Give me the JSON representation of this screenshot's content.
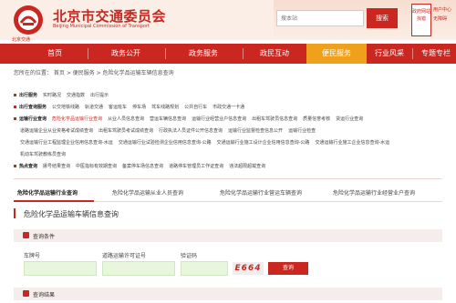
{
  "header": {
    "title": "北京市交通委员会",
    "subtitle": "Beijing Municipal Commission of Transport",
    "logo_text": "北京交通",
    "search_placeholder": "搜本站",
    "search_button": "搜索",
    "badge": "政府网站 找错",
    "user_links": [
      "用户中心",
      "无障碍"
    ]
  },
  "nav": {
    "items": [
      "首页",
      "政务公开",
      "政务服务",
      "政民互动",
      "便民服务",
      "行业风采",
      "专题专栏"
    ],
    "active": "便民服务"
  },
  "breadcrumb": "您所在的位置： 首页 > 便民服务 > 危险化学品运输车辆信息查询",
  "services": [
    {
      "category": "出行服务",
      "links": [
        "实时路况",
        "交通指数",
        "出行提示"
      ]
    },
    {
      "category": "出行查询服务",
      "links": [
        "公交地铁线路",
        "轨道交通",
        "客运班车",
        "停车场",
        "驾车线路规划",
        "公共自行车",
        "市政交通一卡通"
      ]
    },
    {
      "category": "运输行业查询",
      "links": [
        "危险化学品运输行业查询",
        "从业人员信息查询",
        "营运车辆信息查询",
        "运输行业经营业户信息查询",
        "出租车驾驶员信息查询",
        "质量信誉考核",
        "货运行业查询"
      ]
    }
  ],
  "services_extra": [
    [
      "道路运输企业从业资格考试成绩查询",
      "出租车驾驶员考试成绩查询",
      "行政执法人员证件公开信息查询",
      "运输行业监督检查信息公开",
      "运输行业检查"
    ],
    [
      "交通运输行业工程监理企业信用信息查询-水运",
      "交通运输行业试验检测企业信用信息查询-公路",
      "交通运输行业施工设计企业信用信息查询-公路",
      "交通运输行业施工企业信息查询-水运"
    ],
    [
      "机动车驾驶教练员查询"
    ]
  ],
  "hot_services": {
    "category": "热点查询",
    "links": [
      "挪号结果查询",
      "中医指标有效期查询",
      "备案停车场信息查询",
      "道路停车管理员工作证查询",
      "违法超限超载查询"
    ]
  },
  "tabs": [
    "危险化学品运输行业查询",
    "危险化学品运输从业人员查询",
    "危险化学品运输行业营运车辆查询",
    "危险化学品运输行业经营业户查询"
  ],
  "page_title": "危险化学品运输车辆信息查询",
  "query": {
    "section_label": "查询条件",
    "fields": [
      {
        "label": "车牌号",
        "value": ""
      },
      {
        "label": "道路运输许可证号",
        "value": ""
      },
      {
        "label": "验证码",
        "value": ""
      }
    ],
    "captcha_text": "E664",
    "submit": "查询"
  },
  "result": {
    "section_label": "查询结果"
  },
  "colors": {
    "brand": "#c9271f",
    "nav_active": "#f0a11c",
    "input_bg": "#e8f7dc",
    "section_bg": "#f5ecec"
  }
}
